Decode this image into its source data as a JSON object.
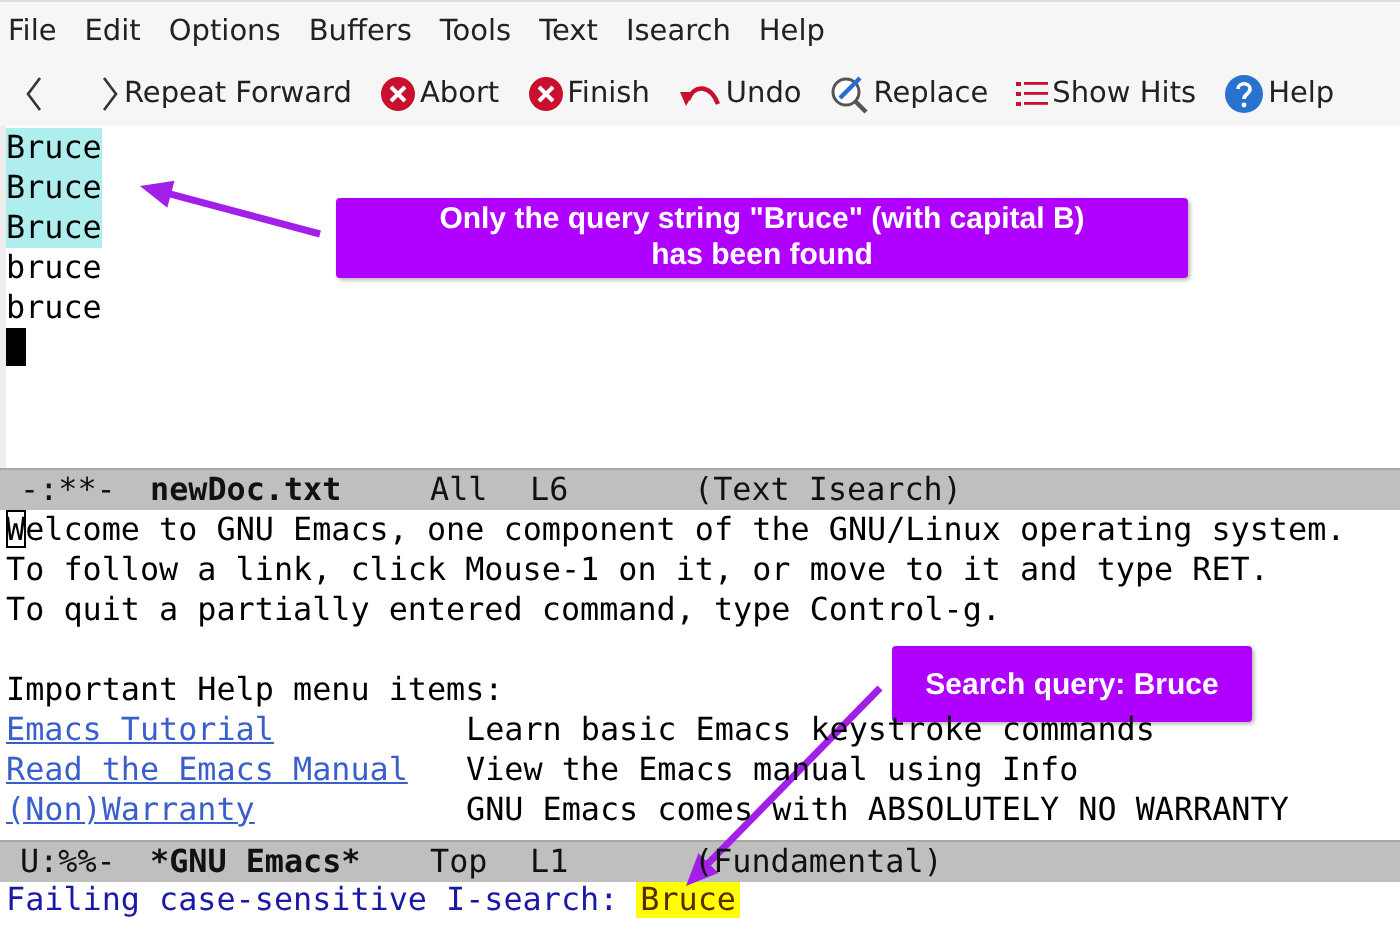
{
  "menu_bar": [
    "File",
    "Edit",
    "Options",
    "Buffers",
    "Tools",
    "Text",
    "Isearch",
    "Help"
  ],
  "toolbar": [
    {
      "kind": "back"
    },
    {
      "kind": "forward",
      "label": "Repeat Forward"
    },
    {
      "kind": "abort",
      "label": "Abort"
    },
    {
      "kind": "finish",
      "label": "Finish"
    },
    {
      "kind": "undo",
      "label": "Undo"
    },
    {
      "kind": "replace",
      "label": "Replace"
    },
    {
      "kind": "hits",
      "label": "Show Hits"
    },
    {
      "kind": "help",
      "label": "Help"
    }
  ],
  "top_buffer": {
    "lines": [
      {
        "text": "Bruce",
        "highlighted": true
      },
      {
        "text": "Bruce",
        "highlighted": true
      },
      {
        "text": "Bruce",
        "highlighted": true
      },
      {
        "text": "bruce",
        "highlighted": false
      },
      {
        "text": "bruce",
        "highlighted": false
      }
    ],
    "cursor": true
  },
  "top_mode_line": {
    "status": "-:**-",
    "buffer": "newDoc.txt",
    "position": "All",
    "line": "L6",
    "mode": "(Text Isearch)"
  },
  "lower_buffer": {
    "hollow_cursor": true,
    "rows": [
      {
        "kind": "text",
        "text": "Welcome to GNU Emacs, one component of the GNU/Linux operating system."
      },
      {
        "kind": "text",
        "text": "To follow a link, click Mouse-1 on it, or move to it and type RET."
      },
      {
        "kind": "text",
        "text": "To quit a partially entered command, type Control-g."
      },
      {
        "kind": "blank"
      },
      {
        "kind": "text",
        "text": "Important Help menu items:"
      },
      {
        "kind": "item",
        "link": "Emacs Tutorial",
        "description": "Learn basic Emacs keystroke commands"
      },
      {
        "kind": "item",
        "link": "Read the Emacs Manual",
        "description": "View the Emacs manual using Info"
      },
      {
        "kind": "item",
        "link": "(Non)Warranty",
        "description": "GNU Emacs comes with ABSOLUTELY NO WARRANTY"
      }
    ]
  },
  "bottom_mode_line": {
    "status": "U:%%-",
    "buffer": "*GNU Emacs*",
    "position": "Top",
    "line": "L1",
    "mode": "(Fundamental)"
  },
  "minibuffer": {
    "prompt": "Failing case-sensitive I-search:",
    "query": "Bruce"
  },
  "annotations": [
    {
      "text": "Only the query string \"Bruce\" (with capital B) has been found"
    },
    {
      "text": "Search query: Bruce"
    }
  ]
}
